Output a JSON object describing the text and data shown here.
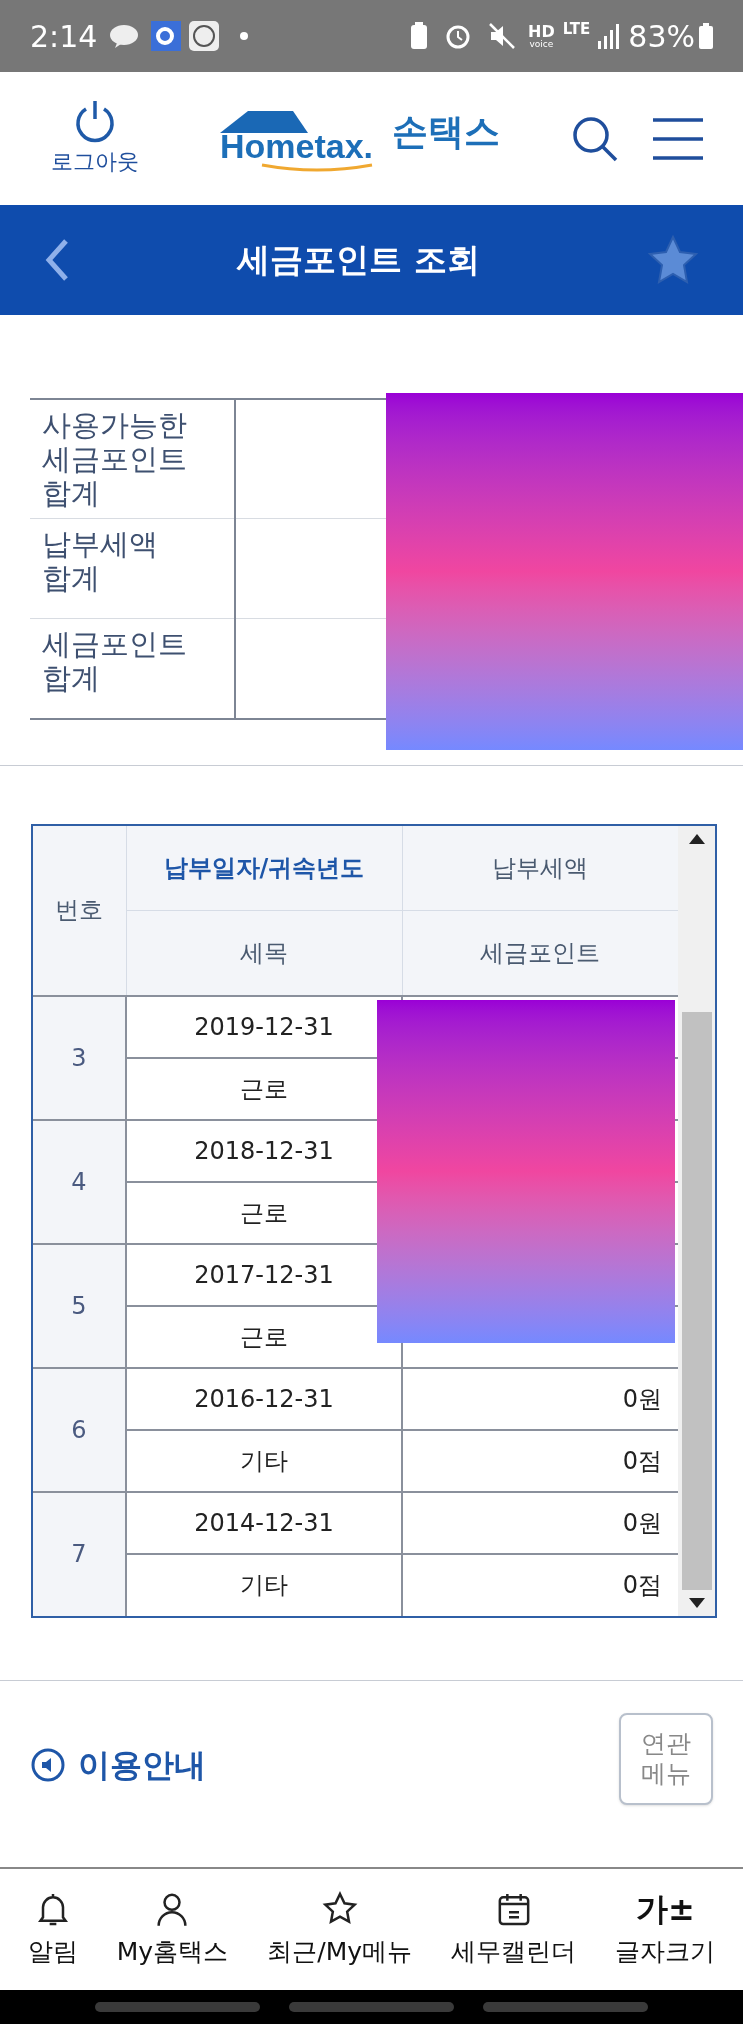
{
  "status_bar": {
    "time": "2:14",
    "hd": "HD",
    "voice": "voice",
    "network": "LTE",
    "battery": "83%"
  },
  "header": {
    "logout_label": "로그아웃",
    "logo_wordmark": "Hometax.",
    "logo_name": "손택스"
  },
  "title_bar": {
    "title": "세금포인트 조회",
    "favorite": false
  },
  "summary": {
    "rows": [
      {
        "label": "사용가능한 세금포인트 합계"
      },
      {
        "label": "납부세액 합계"
      },
      {
        "label": "세금포인트 합계"
      }
    ]
  },
  "history": {
    "columns": {
      "number": "번호",
      "date": "납부일자/귀속년도",
      "amount": "납부세액",
      "category": "세목",
      "points": "세금포인트"
    },
    "rows": [
      {
        "number": "3",
        "date": "2019-12-31",
        "category": "근로"
      },
      {
        "number": "4",
        "date": "2018-12-31",
        "category": "근로"
      },
      {
        "number": "5",
        "date": "2017-12-31",
        "category": "근로"
      },
      {
        "number": "6",
        "date": "2016-12-31",
        "amount": "0원",
        "category": "기타",
        "points": "0점"
      },
      {
        "number": "7",
        "date": "2014-12-31",
        "amount": "0원",
        "category": "기타",
        "points": "0점"
      }
    ]
  },
  "guide": {
    "title": "이용안내",
    "related_button": "연관 메뉴"
  },
  "bottom_nav": [
    {
      "kind": "bell",
      "label": "알림"
    },
    {
      "kind": "person",
      "label": "My홈택스"
    },
    {
      "kind": "star",
      "label": "최근/My메뉴"
    },
    {
      "kind": "calendar",
      "label": "세무캘린더"
    },
    {
      "kind": "fontsize",
      "label": "글자크기",
      "glyph": "가±"
    }
  ]
}
